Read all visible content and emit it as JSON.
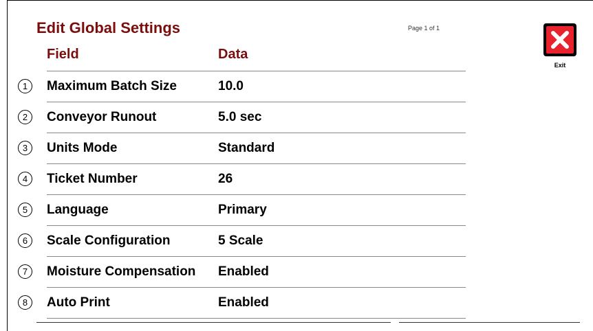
{
  "title": "Edit Global Settings",
  "page_indicator": "Page 1 of 1",
  "columns": {
    "field": "Field",
    "data": "Data"
  },
  "exit": {
    "label": "Exit",
    "icon": "close-x-icon",
    "color": "#e8232e"
  },
  "accent_color": "#7b0d0d",
  "rows": [
    {
      "num": "1",
      "field": "Maximum Batch Size",
      "value": "10.0"
    },
    {
      "num": "2",
      "field": "Conveyor Runout",
      "value": "5.0 sec"
    },
    {
      "num": "3",
      "field": "Units Mode",
      "value": "Standard"
    },
    {
      "num": "4",
      "field": "Ticket Number",
      "value": "26"
    },
    {
      "num": "5",
      "field": "Language",
      "value": "Primary"
    },
    {
      "num": "6",
      "field": "Scale Configuration",
      "value": "5 Scale"
    },
    {
      "num": "7",
      "field": "Moisture Compensation",
      "value": "Enabled"
    },
    {
      "num": "8",
      "field": "Auto Print",
      "value": "Enabled"
    }
  ]
}
